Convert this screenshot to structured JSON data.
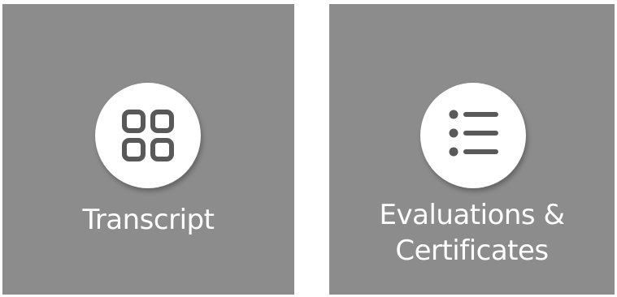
{
  "tiles": [
    {
      "id": "transcript",
      "label": "Transcript",
      "icon": "grid-icon"
    },
    {
      "id": "evaluations-certificates",
      "label_line1": "Evaluations &",
      "label_line2": "Certificates",
      "icon": "list-icon"
    }
  ],
  "colors": {
    "tile_background": "#8c8c8c",
    "icon_circle": "#ffffff",
    "icon_glyph": "#595959",
    "label_text": "#ffffff"
  }
}
